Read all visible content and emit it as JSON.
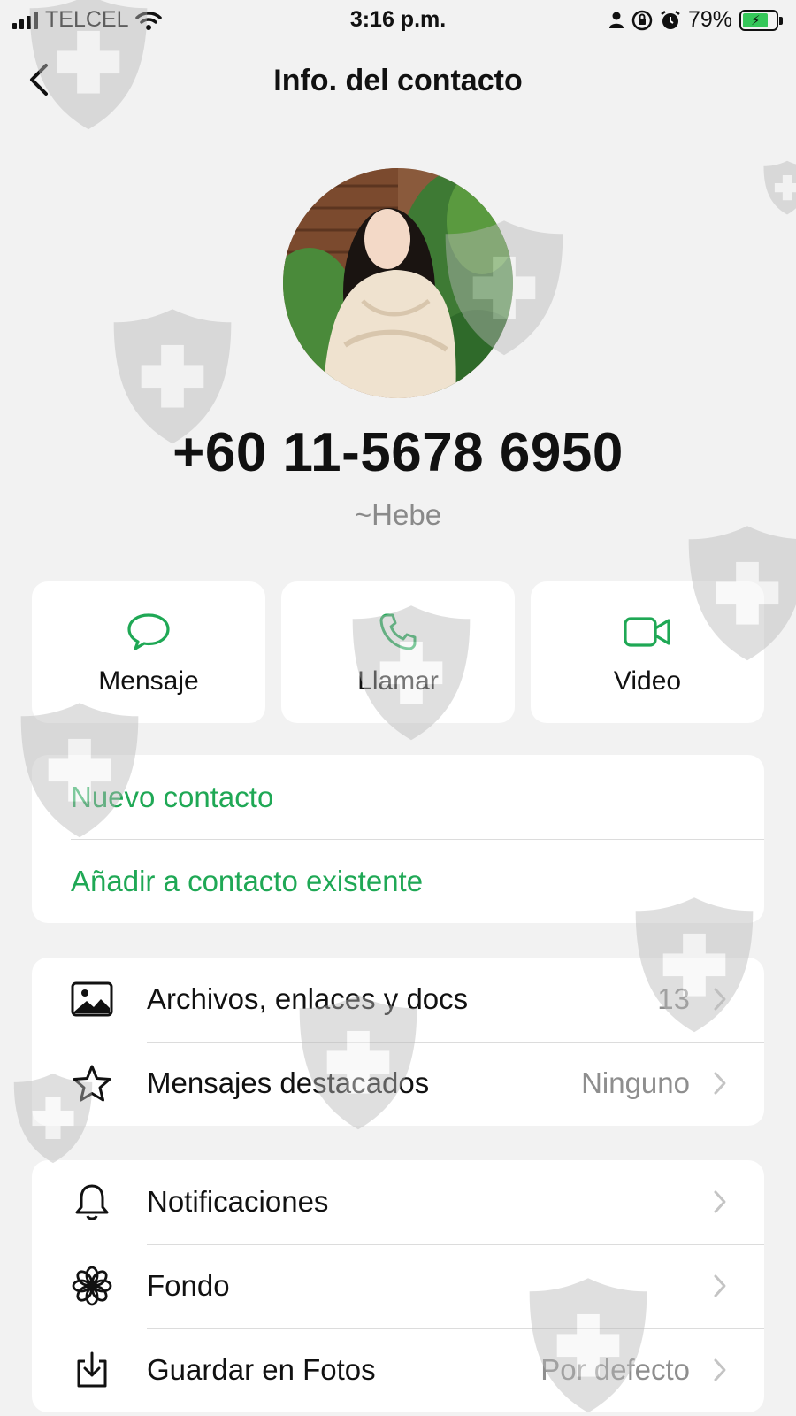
{
  "status_bar": {
    "carrier": "TELCEL",
    "time": "3:16 p.m.",
    "battery": "79%"
  },
  "header": {
    "title": "Info. del contacto"
  },
  "contact": {
    "phone": "+60 11-5678 6950",
    "name": "~Hebe"
  },
  "actions": [
    {
      "label": "Mensaje",
      "icon": "message-icon"
    },
    {
      "label": "Llamar",
      "icon": "phone-icon"
    },
    {
      "label": "Video",
      "icon": "video-icon"
    }
  ],
  "contact_options": [
    {
      "label": "Nuevo contacto"
    },
    {
      "label": "Añadir a contacto existente"
    }
  ],
  "media_section": [
    {
      "label": "Archivos, enlaces y docs",
      "value": "13",
      "icon": "image-icon"
    },
    {
      "label": "Mensajes destacados",
      "value": "Ninguno",
      "icon": "star-icon"
    }
  ],
  "settings_section": [
    {
      "label": "Notificaciones",
      "value": "",
      "icon": "bell-icon"
    },
    {
      "label": "Fondo",
      "value": "",
      "icon": "flower-icon"
    },
    {
      "label": "Guardar en Fotos",
      "value": "Por defecto",
      "icon": "download-icon"
    }
  ],
  "colors": {
    "accent": "#1fa855",
    "background": "#f2f2f2",
    "card": "#ffffff",
    "secondary_text": "#8e8e8e"
  }
}
